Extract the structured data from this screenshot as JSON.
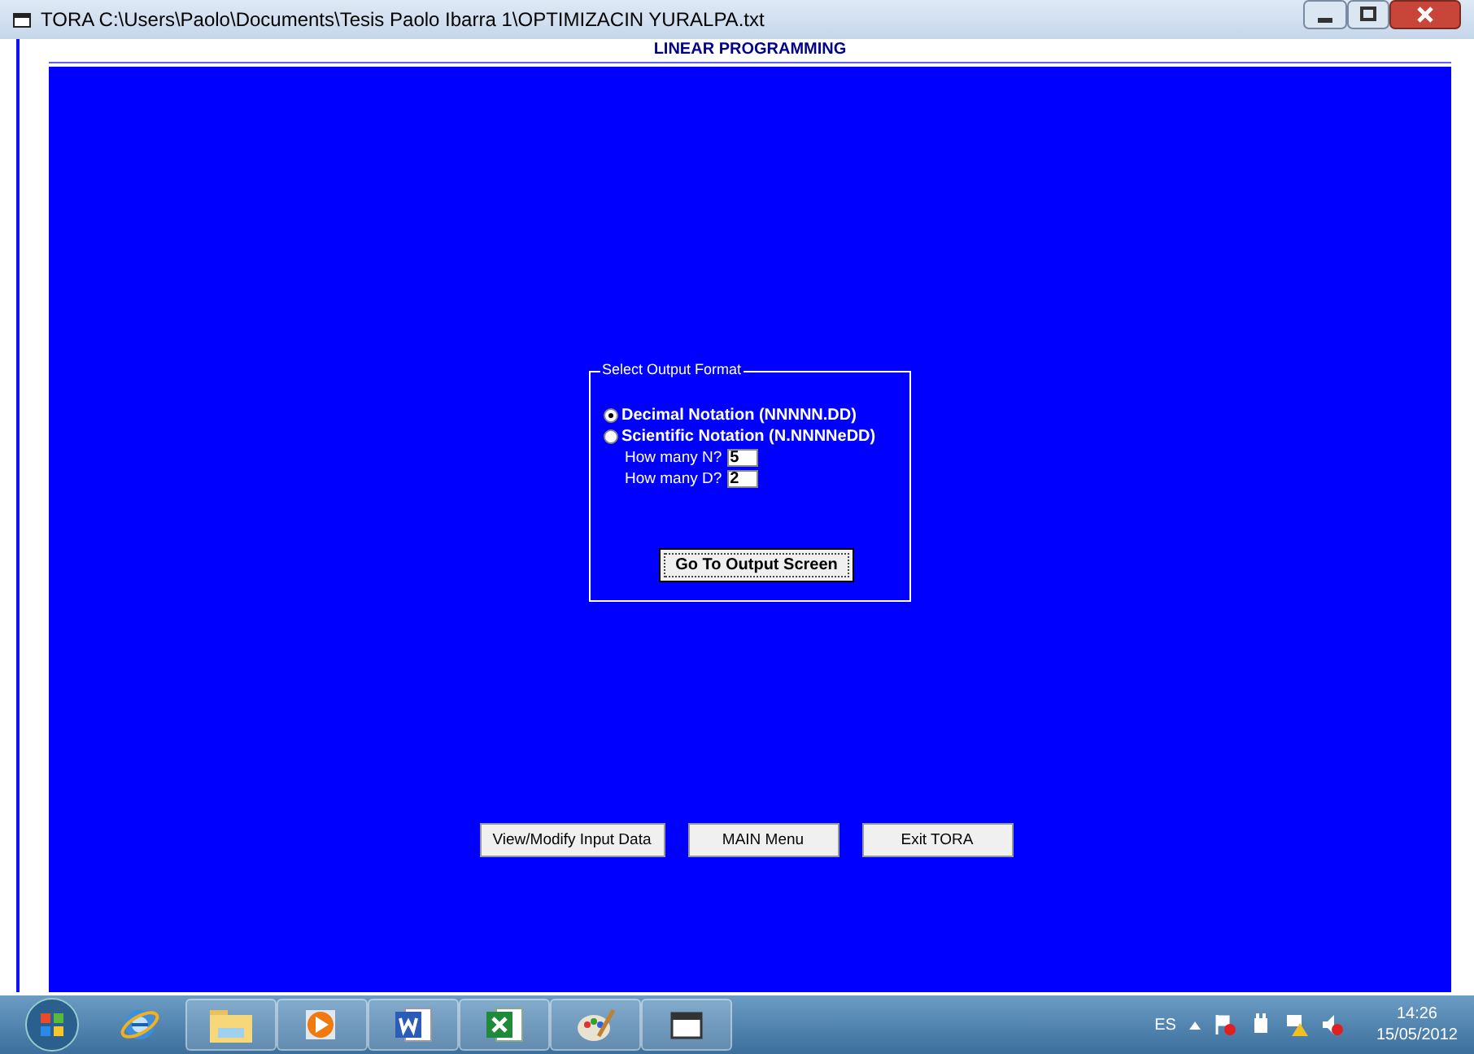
{
  "window": {
    "title": "TORA  C:\\Users\\Paolo\\Documents\\Tesis Paolo Ibarra 1\\OPTIMIZACIN YURALPA.txt"
  },
  "header": "LINEAR PROGRAMMING",
  "output_format": {
    "title": "Select Output Format",
    "options": [
      {
        "label": "Decimal Notation (NNNNN.DD)",
        "selected": true
      },
      {
        "label": "Scientific Notation (N.NNNNeDD)",
        "selected": false
      }
    ],
    "fields": [
      {
        "label": "How many N?",
        "value": "5"
      },
      {
        "label": "How many D?",
        "value": "2"
      }
    ],
    "button": "Go To Output Screen"
  },
  "buttons": [
    "View/Modify Input Data",
    "MAIN Menu",
    "Exit TORA"
  ],
  "taskbar": {
    "apps": [
      {
        "kind": "ie"
      },
      {
        "kind": "folder"
      },
      {
        "kind": "media"
      },
      {
        "kind": "word"
      },
      {
        "kind": "excel"
      },
      {
        "kind": "paint"
      },
      {
        "kind": "window"
      }
    ],
    "language": "ES",
    "time": "14:26",
    "date": "15/05/2012"
  }
}
